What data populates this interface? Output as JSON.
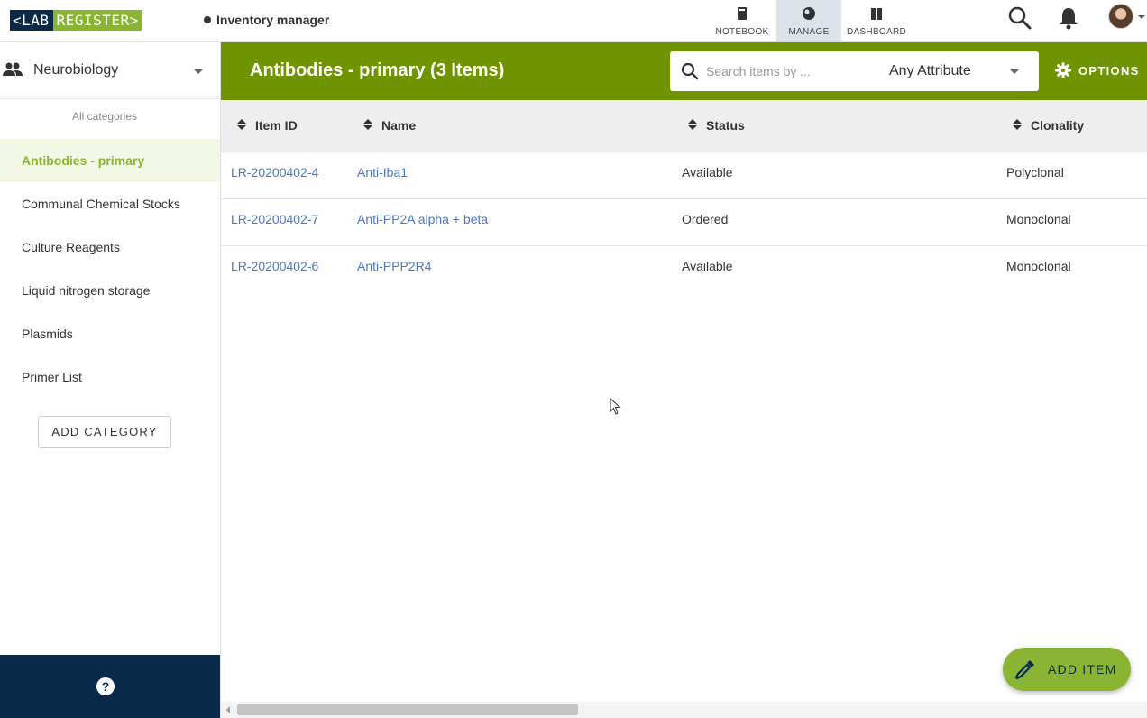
{
  "app": {
    "logo_left": "<LAB",
    "logo_right": "REGISTER>",
    "context_label": "Inventory manager"
  },
  "nav": {
    "tabs": [
      {
        "label": "NOTEBOOK",
        "icon": "notebook-icon",
        "active": false
      },
      {
        "label": "MANAGE",
        "icon": "manage-icon",
        "active": true
      },
      {
        "label": "DASHBOARD",
        "icon": "dashboard-icon",
        "active": false
      }
    ]
  },
  "sidebar": {
    "group_name": "Neurobiology",
    "all_categories_label": "All categories",
    "categories": [
      {
        "label": "Antibodies - primary",
        "active": true
      },
      {
        "label": "Communal Chemical Stocks",
        "active": false
      },
      {
        "label": "Culture Reagents",
        "active": false
      },
      {
        "label": "Liquid nitrogen storage",
        "active": false
      },
      {
        "label": "Plasmids",
        "active": false
      },
      {
        "label": "Primer List",
        "active": false
      }
    ],
    "add_category_label": "ADD CATEGORY",
    "help_label": "?"
  },
  "header": {
    "title": "Antibodies - primary (3 Items)",
    "search_placeholder": "Search items by ...",
    "search_value": "",
    "attribute_selected": "Any Attribute",
    "options_label": "OPTIONS"
  },
  "table": {
    "columns": [
      "Item ID",
      "Name",
      "Status",
      "Clonality"
    ],
    "rows": [
      {
        "id": "LR-20200402-4",
        "name": "Anti-Iba1",
        "status": "Available",
        "clonality": "Polyclonal"
      },
      {
        "id": "LR-20200402-7",
        "name": "Anti-PP2A alpha + beta",
        "status": "Ordered",
        "clonality": "Monoclonal"
      },
      {
        "id": "LR-20200402-6",
        "name": "Anti-PPP2R4",
        "status": "Available",
        "clonality": "Monoclonal"
      }
    ]
  },
  "fab": {
    "label": "ADD ITEM"
  },
  "colors": {
    "brand_navy": "#0b2a4a",
    "brand_green": "#8ab534",
    "header_green": "#6f9400",
    "link_blue": "#4a78c0"
  }
}
